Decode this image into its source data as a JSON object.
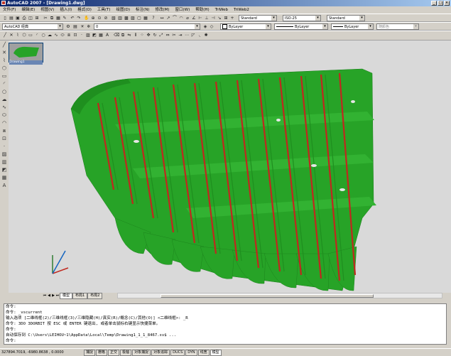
{
  "window": {
    "title": "AutoCAD 2007 - [Drawing1.dwg]"
  },
  "menu": {
    "items": [
      "文件(F)",
      "编辑(E)",
      "视图(V)",
      "插入(I)",
      "格式(O)",
      "工具(T)",
      "绘图(D)",
      "标注(N)",
      "修改(M)",
      "窗口(W)",
      "帮助(H)",
      "TriWeb",
      "TriWeb2"
    ],
    "text_style": "Standard",
    "dim_style": "ISO-25",
    "table_style": "Standard"
  },
  "toolbar2": {
    "workspace": "AutoCAD 经典",
    "layer": "0",
    "dim_style": "ISO-25",
    "color": "ByLayer",
    "linetype": "ByLayer",
    "lineweight": "ByLayer",
    "plotstyle": "随颜色"
  },
  "drawing": {
    "thumbnail_label": "Drawing1"
  },
  "tabs": [
    "模型",
    "布局1",
    "布局2"
  ],
  "command": {
    "lines": [
      "命令:",
      "命令: _vscurrent",
      "输入选项 [二维线框(2)/三维线框(3)/三维隐藏(H)/真实(R)/概念(C)/其他(O)] <二维线框>: _R",
      "命令: 3DO 3DORBIT 按 ESC 或 ENTER 键退出, 或者单击鼠标右键显示快捷菜单。",
      "命令:",
      "自动保存到 C:\\Users\\LEIHOU~1\\AppData\\Local\\Temp\\Drawing1_1_1_8467.sv$ ...",
      "命令:"
    ]
  },
  "status": {
    "coords": "327894.7019, -6980.8638 , 0.0000",
    "buttons": [
      "捕捉",
      "栅格",
      "正交",
      "极轴",
      "对象捕捉",
      "对象追踪",
      "DUCS",
      "DYN",
      "线宽",
      "模型"
    ]
  },
  "colors": {
    "hull": "#27a327",
    "frame_red": "#c0281e",
    "title_blue": "#0a246a"
  }
}
